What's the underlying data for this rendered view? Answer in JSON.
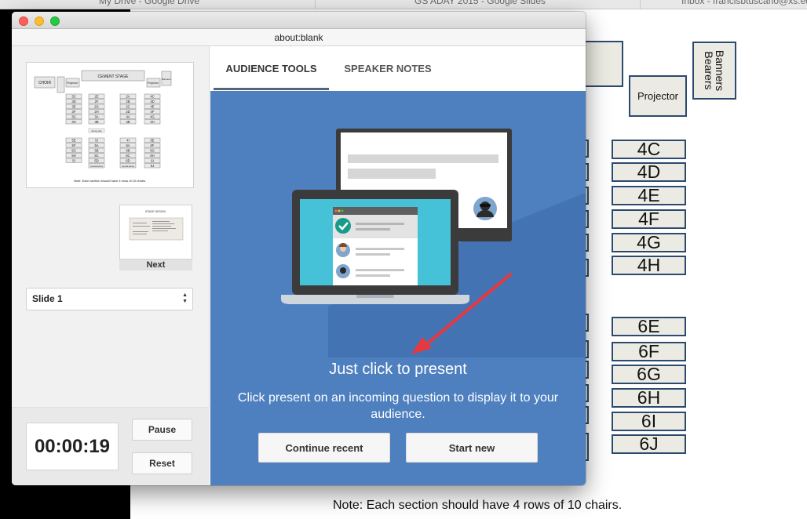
{
  "browser_tabs": [
    "My Drive - Google Drive",
    "GS ADAY 2015 - Google Slides",
    "Inbox - francisbtuscano@xs.edu"
  ],
  "background_slide": {
    "banners_label": "Banners Bearers",
    "projector_label": "Projector",
    "row4": [
      "4C",
      "4D",
      "4E",
      "4F",
      "4G",
      "4H"
    ],
    "row6": [
      "6E",
      "6F",
      "6G",
      "6H",
      "6I",
      "6J"
    ],
    "note": "Note: Each section should have 4 rows of 10 chairs."
  },
  "window": {
    "url": "about:blank",
    "colors": {
      "close": "#fc5f57",
      "minimize": "#fdbc2e",
      "zoom": "#28c840",
      "panel_blue": "#4e7fbf"
    }
  },
  "sidebar": {
    "current_thumb": {
      "stage": "CEMENT STAGE",
      "choir": "CHOIR",
      "projector": "Projector",
      "banners": "Banners",
      "note": "Note: Each section should have 4 rows of 10 chairs.",
      "col1a": [
        "3C",
        "3D",
        "3E",
        "3F",
        "3G",
        "3H"
      ],
      "col2a": [
        "2E",
        "2F",
        "2G",
        "2H",
        "3A",
        "3B"
      ],
      "col3a": [
        "2A",
        "2B",
        "2C",
        "2D",
        "4A",
        "4B"
      ],
      "col4a": [
        "4C",
        "4D",
        "4E",
        "4F",
        "4G",
        "4H"
      ],
      "aisle": "offering table",
      "col1b": [
        "5E",
        "5F",
        "5G",
        "5H",
        "5I"
      ],
      "col2b": [
        "5I",
        "5A",
        "5B",
        "5C",
        "5D",
        "Central Admin"
      ],
      "col3b": [
        "4I",
        "6A",
        "6B",
        "6C",
        "6D",
        "Central Admin"
      ],
      "col4b": [
        "6E",
        "6F",
        "6G",
        "6H",
        "6I",
        "6J"
      ]
    },
    "next_thumb": {
      "title": "STAGE DESIGN",
      "label": "Next"
    },
    "slide_select": "Slide 1",
    "timer": "00:00:19",
    "pause_label": "Pause",
    "reset_label": "Reset"
  },
  "main": {
    "tabs": [
      {
        "label": "AUDIENCE TOOLS",
        "active": true
      },
      {
        "label": "SPEAKER NOTES",
        "active": false
      }
    ],
    "headline": "Just click to present",
    "description": "Click present on an incoming question to display it to your audience.",
    "continue_label": "Continue recent",
    "start_label": "Start new"
  }
}
